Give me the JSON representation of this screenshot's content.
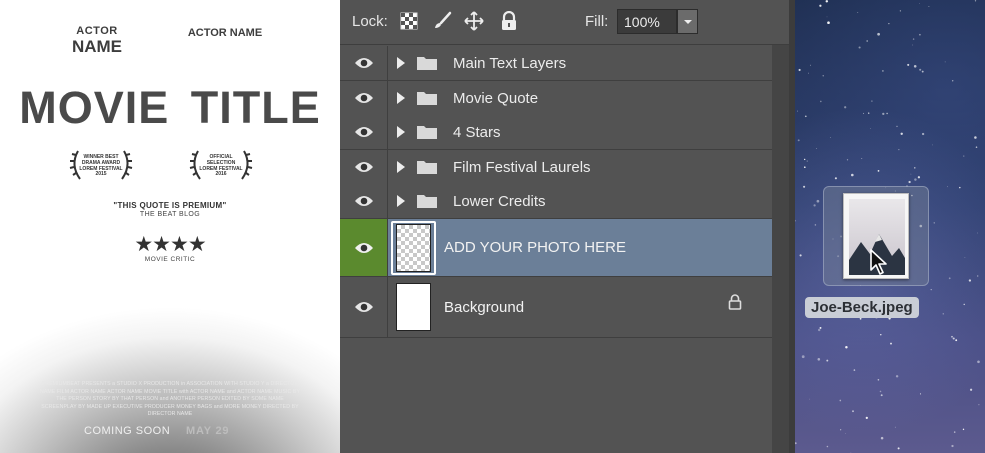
{
  "poster": {
    "actor1_line1": "ACTOR",
    "actor1_line2": "NAME",
    "actor2": "ACTOR NAME",
    "title": "MOVIE TITLE",
    "laurel_left_text": "WINNER BEST DRAMA AWARD LOREM FESTIVAL 2015",
    "laurel_right_text": "OFFICIAL SELECTION LOREM FESTIVAL 2016",
    "quote": "\"THIS QUOTE IS PREMIUM\"",
    "quote_source": "THE BEAT BLOG",
    "stars": "★★★★",
    "critic": "MOVIE CRITIC",
    "credits": "PREMIUMBEAT PRESENTS a STUDIO X PRODUCTION in ASSOCIATION WITH STUDIO Y a DIRECTOR NAME FILM ACTOR NAME ACTOR NAME MOVIE TITLE with ACTOR NAME and ACTOR NAME MUSIC BY THE PERSON STORY BY THAT PERSON and ANOTHER PERSON EDITED BY SOME NAME SCREENPLAY BY MADE UP EXECUTIVE PRODUCER MONEY BAGS and MORE MONEY DIRECTED BY DIRECTOR NAME",
    "coming_soon": "COMING SOON",
    "date": "MAY 29"
  },
  "layers_panel": {
    "lock_label": "Lock:",
    "fill_label": "Fill:",
    "fill_value": "100%",
    "lock_icons": [
      "transparency-lock-icon",
      "brush-lock-icon",
      "move-lock-icon",
      "padlock-icon"
    ],
    "groups": [
      {
        "label": "Main Text Layers"
      },
      {
        "label": "Movie Quote"
      },
      {
        "label": "4 Stars"
      },
      {
        "label": "Film Festival Laurels"
      },
      {
        "label": "Lower Credits"
      }
    ],
    "selected_layer": {
      "label": "ADD YOUR PHOTO HERE"
    },
    "background_layer": {
      "label": "Background",
      "locked": true
    }
  },
  "desktop": {
    "file_name": "Joe-Beck.jpeg"
  },
  "colors": {
    "panel_bg": "#535353",
    "selected_row": "#6b7f98",
    "eye_selected": "#5b8a2e"
  }
}
